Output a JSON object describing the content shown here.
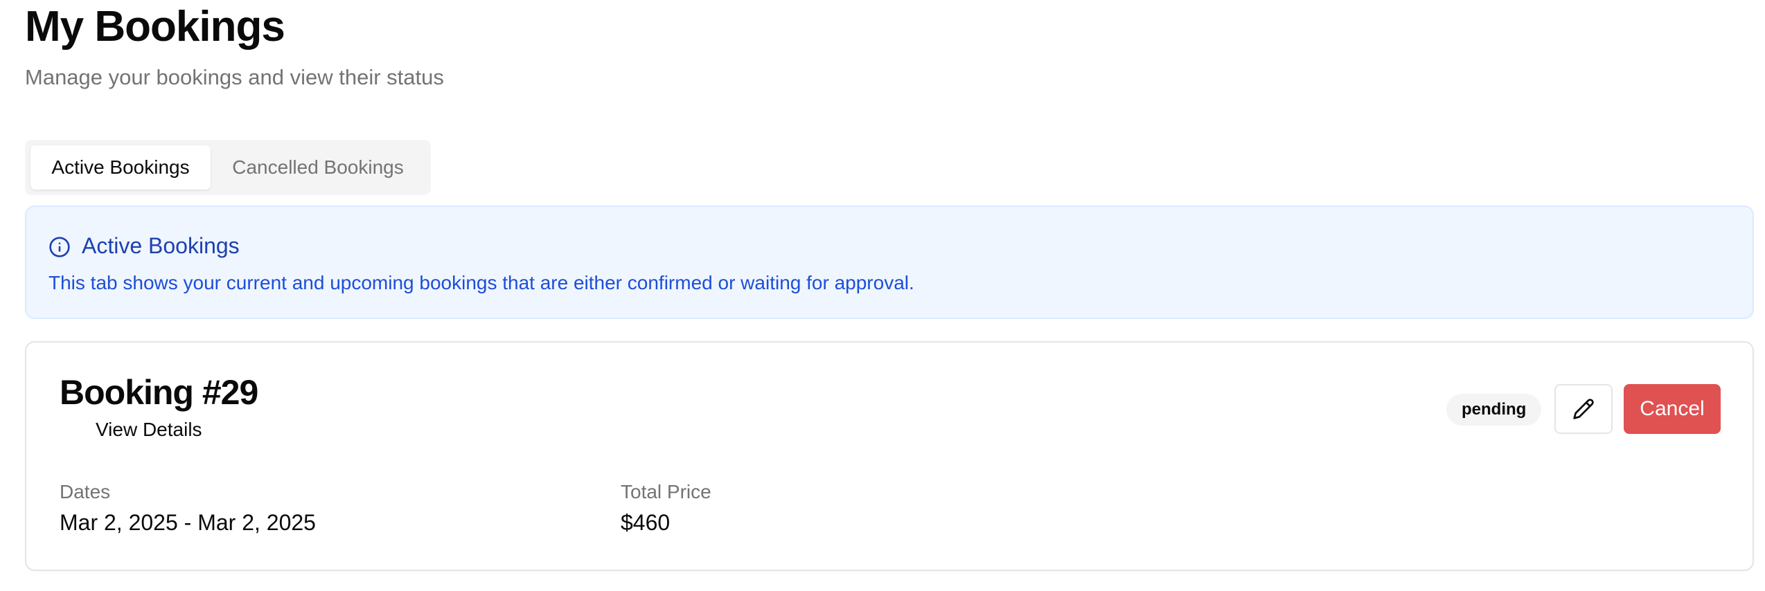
{
  "header": {
    "title": "My Bookings",
    "subtitle": "Manage your bookings and view their status"
  },
  "tabs": [
    {
      "label": "Active Bookings",
      "active": true
    },
    {
      "label": "Cancelled Bookings",
      "active": false
    }
  ],
  "info_alert": {
    "icon": "info-icon",
    "title": "Active Bookings",
    "text": "This tab shows your current and upcoming bookings that are either confirmed or waiting for approval."
  },
  "bookings": [
    {
      "title": "Booking #29",
      "view_details_label": "View Details",
      "status": "pending",
      "edit_icon": "pencil-icon",
      "cancel_label": "Cancel",
      "dates_label": "Dates",
      "dates_value": "Mar 2, 2025 - Mar 2, 2025",
      "price_label": "Total Price",
      "price_value": "$460"
    }
  ],
  "colors": {
    "info_background": "#eff6ff",
    "info_text": "#1d4ed8",
    "cancel_button": "#e05151"
  }
}
